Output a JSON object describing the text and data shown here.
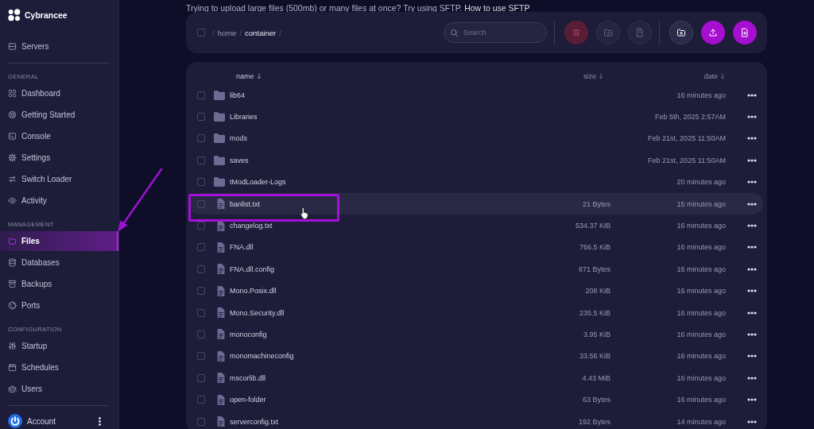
{
  "notice": {
    "text": "Trying to upload large files (500mb) or many files at once? Try using SFTP.",
    "link": "How to use SFTP"
  },
  "sidebar": {
    "brand": "Cybrancee",
    "top_items": [
      {
        "label": "Servers",
        "selected": false
      }
    ],
    "sections": [
      {
        "heading": "GENERAL",
        "items": [
          {
            "label": "Dashboard",
            "selected": false
          },
          {
            "label": "Getting Started",
            "selected": false
          },
          {
            "label": "Console",
            "selected": false
          },
          {
            "label": "Settings",
            "selected": false
          },
          {
            "label": "Switch Loader",
            "selected": false
          },
          {
            "label": "Activity",
            "selected": false
          }
        ]
      },
      {
        "heading": "MANAGEMENT",
        "items": [
          {
            "label": "Files",
            "selected": true
          },
          {
            "label": "Databases",
            "selected": false
          },
          {
            "label": "Backups",
            "selected": false
          },
          {
            "label": "Ports",
            "selected": false
          }
        ]
      },
      {
        "heading": "CONFIGURATION",
        "items": [
          {
            "label": "Startup",
            "selected": false
          },
          {
            "label": "Schedules",
            "selected": false
          },
          {
            "label": "Users",
            "selected": false
          }
        ]
      }
    ],
    "account": {
      "label": "Account"
    }
  },
  "toolbar": {
    "select_all": {
      "checked": false
    },
    "breadcrumb": {
      "separator": "/",
      "parts": [
        {
          "label": "home",
          "current": false
        },
        {
          "label": "container",
          "current": true
        }
      ]
    },
    "search": {
      "placeholder": "Search"
    },
    "button_groups": [
      [
        {
          "kind": "delete",
          "disabled": true
        },
        {
          "kind": "move",
          "disabled": true
        },
        {
          "kind": "archive",
          "disabled": true
        }
      ],
      [
        {
          "kind": "new_folder",
          "disabled": false
        },
        {
          "kind": "upload",
          "disabled": false
        },
        {
          "kind": "new_file",
          "disabled": false
        }
      ]
    ]
  },
  "table": {
    "columns": [
      {
        "label": "name",
        "selected": true
      },
      {
        "label": "size",
        "selected": false
      },
      {
        "label": "date",
        "selected": false
      }
    ],
    "rows": [
      {
        "kind": "folder",
        "name": "lib64",
        "date": "16 minutes ago",
        "checked": false,
        "highlighted": false
      },
      {
        "kind": "folder",
        "name": "Libraries",
        "date": "Feb 5th, 2025 2:57AM",
        "checked": false,
        "highlighted": false
      },
      {
        "kind": "folder",
        "name": "mods",
        "date": "Feb 21st, 2025 11:50AM",
        "checked": false,
        "highlighted": false
      },
      {
        "kind": "folder",
        "name": "saves",
        "date": "Feb 21st, 2025 11:50AM",
        "checked": false,
        "highlighted": false
      },
      {
        "kind": "folder",
        "name": "tModLoader-Logs",
        "date": "20 minutes ago",
        "checked": false,
        "highlighted": false
      },
      {
        "kind": "file",
        "name": "banlist.txt",
        "size": "21 Bytes",
        "date": "15 minutes ago",
        "checked": false,
        "highlighted": true
      },
      {
        "kind": "file",
        "name": "changelog.txt",
        "size": "534.37 KiB",
        "date": "16 minutes ago",
        "checked": false,
        "highlighted": false
      },
      {
        "kind": "file",
        "name": "FNA.dll",
        "size": "766.5 KiB",
        "date": "16 minutes ago",
        "checked": false,
        "highlighted": false
      },
      {
        "kind": "file",
        "name": "FNA.dll.config",
        "size": "871 Bytes",
        "date": "16 minutes ago",
        "checked": false,
        "highlighted": false
      },
      {
        "kind": "file",
        "name": "Mono.Posix.dll",
        "size": "208 KiB",
        "date": "16 minutes ago",
        "checked": false,
        "highlighted": false
      },
      {
        "kind": "file",
        "name": "Mono.Security.dll",
        "size": "235.5 KiB",
        "date": "16 minutes ago",
        "checked": false,
        "highlighted": false
      },
      {
        "kind": "file",
        "name": "monoconfig",
        "size": "3.95 KiB",
        "date": "16 minutes ago",
        "checked": false,
        "highlighted": false
      },
      {
        "kind": "file",
        "name": "monomachineconfig",
        "size": "33.56 KiB",
        "date": "16 minutes ago",
        "checked": false,
        "highlighted": false
      },
      {
        "kind": "file",
        "name": "mscorlib.dll",
        "size": "4.43 MiB",
        "date": "16 minutes ago",
        "checked": false,
        "highlighted": false
      },
      {
        "kind": "file",
        "name": "open-folder",
        "size": "63 Bytes",
        "date": "16 minutes ago",
        "checked": false,
        "highlighted": false
      },
      {
        "kind": "file",
        "name": "serverconfig.txt",
        "size": "192 Bytes",
        "date": "14 minutes ago",
        "checked": false,
        "highlighted": false
      }
    ]
  },
  "annotations": [
    {
      "kind": "arrow"
    },
    {
      "kind": "frame"
    },
    {
      "kind": "cursor"
    }
  ]
}
